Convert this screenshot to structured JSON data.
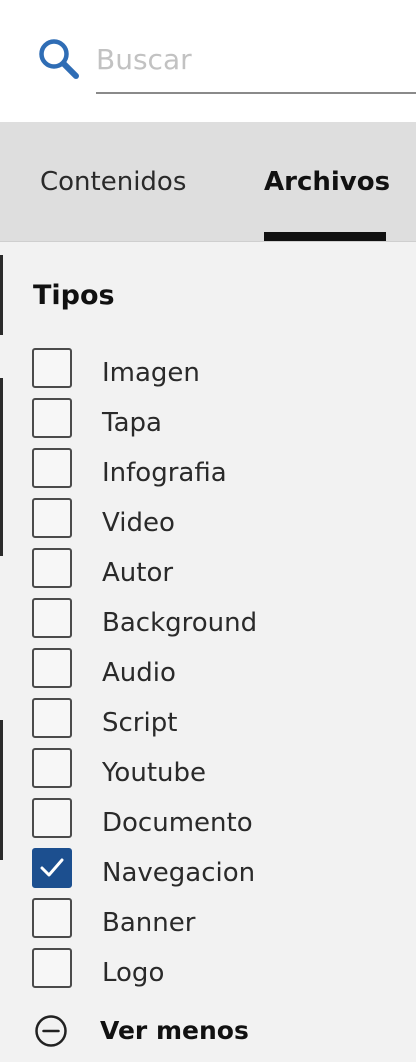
{
  "search": {
    "placeholder": "Buscar",
    "icon": "search-icon",
    "icon_color": "#2f6db5"
  },
  "tabs": [
    {
      "label": "Contenidos",
      "active": false
    },
    {
      "label": "Archivos",
      "active": true
    }
  ],
  "filters": {
    "title": "Tipos",
    "types": [
      {
        "label": "Imagen",
        "checked": false
      },
      {
        "label": "Tapa",
        "checked": false
      },
      {
        "label": "Infografia",
        "checked": false
      },
      {
        "label": "Video",
        "checked": false
      },
      {
        "label": "Autor",
        "checked": false
      },
      {
        "label": "Background",
        "checked": false
      },
      {
        "label": "Audio",
        "checked": false
      },
      {
        "label": "Script",
        "checked": false
      },
      {
        "label": "Youtube",
        "checked": false
      },
      {
        "label": "Documento",
        "checked": false
      },
      {
        "label": "Navegacion",
        "checked": true
      },
      {
        "label": "Banner",
        "checked": false
      },
      {
        "label": "Logo",
        "checked": false
      }
    ],
    "toggle_label": "Ver menos",
    "toggle_icon": "minus-circle-icon"
  },
  "colors": {
    "accent": "#1c4f8f",
    "search_icon": "#2f6db5",
    "tab_bar": "#dedede",
    "panel": "#f2f2f2"
  }
}
